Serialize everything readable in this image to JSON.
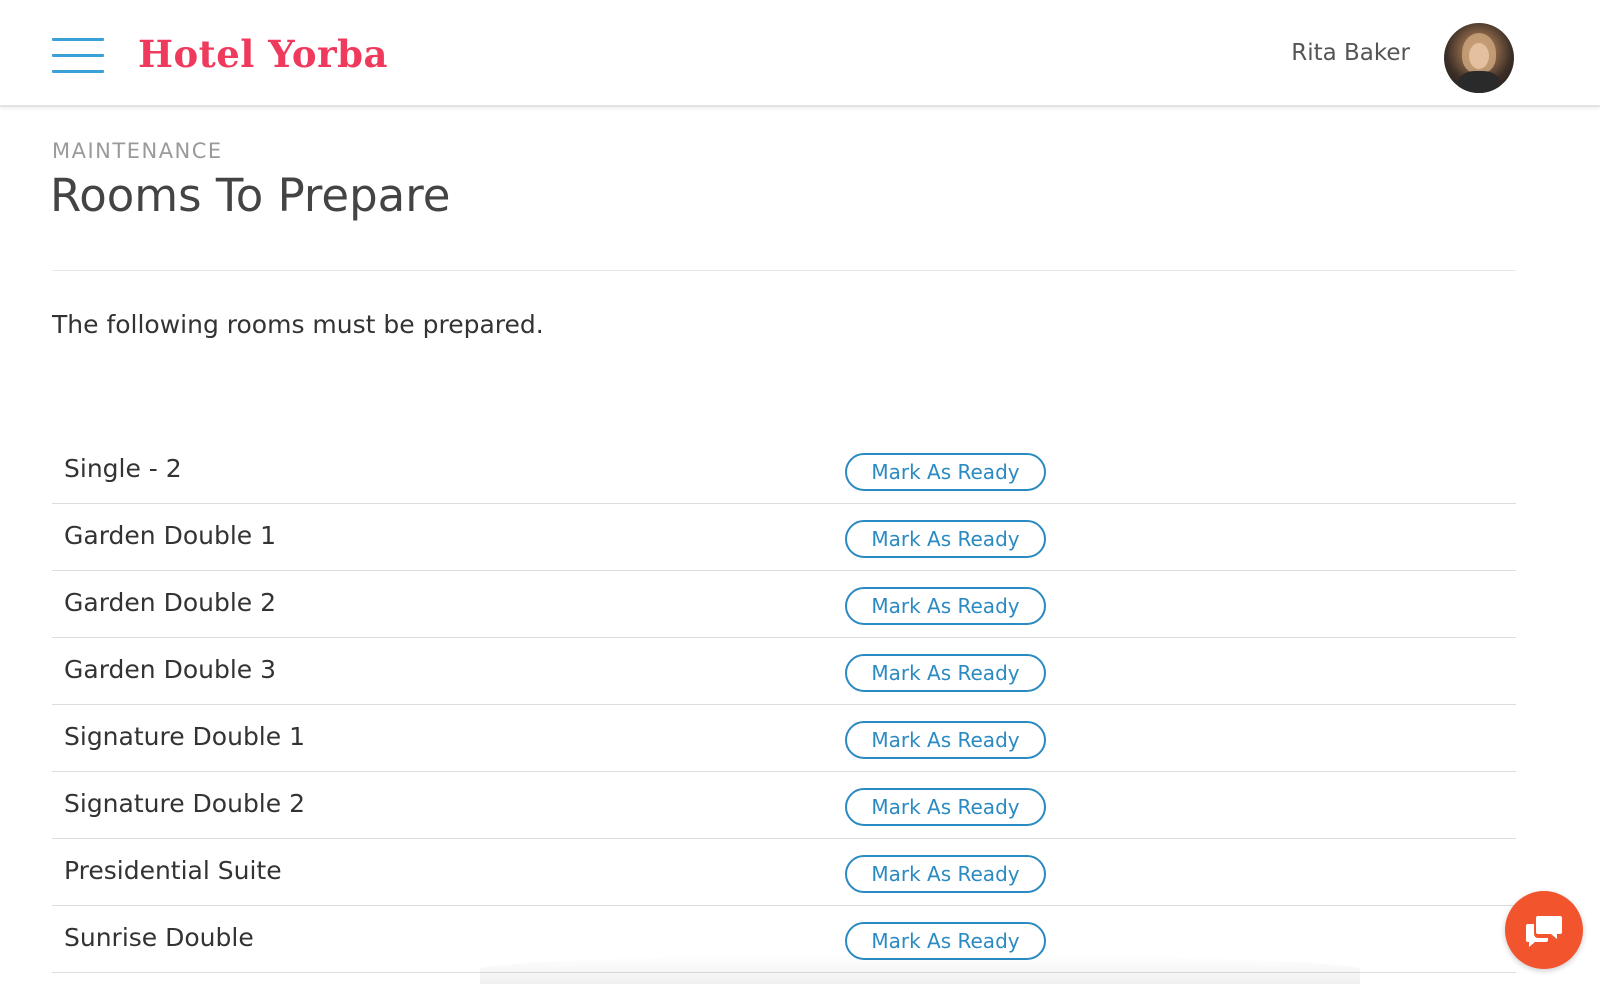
{
  "header": {
    "brand": "Hotel Yorba",
    "menu_icon": "hamburger-menu-icon",
    "user_name": "Rita Baker",
    "avatar_icon": "user-avatar",
    "brand_color": "#ef3a5d",
    "accent_color": "#3aa0d8"
  },
  "page": {
    "section": "MAINTENANCE",
    "title": "Rooms To Prepare",
    "intro": "The following rooms must be prepared."
  },
  "rooms": [
    {
      "name": "Single - 2",
      "action": "Mark As Ready"
    },
    {
      "name": "Garden Double 1",
      "action": "Mark As Ready"
    },
    {
      "name": "Garden Double 2",
      "action": "Mark As Ready"
    },
    {
      "name": "Garden Double 3",
      "action": "Mark As Ready"
    },
    {
      "name": "Signature Double 1",
      "action": "Mark As Ready"
    },
    {
      "name": "Signature Double 2",
      "action": "Mark As Ready"
    },
    {
      "name": "Presidential Suite",
      "action": "Mark As Ready"
    },
    {
      "name": "Sunrise Double",
      "action": "Mark As Ready"
    }
  ],
  "chat": {
    "icon": "chat-bubbles-icon",
    "color": "#f2542d"
  }
}
